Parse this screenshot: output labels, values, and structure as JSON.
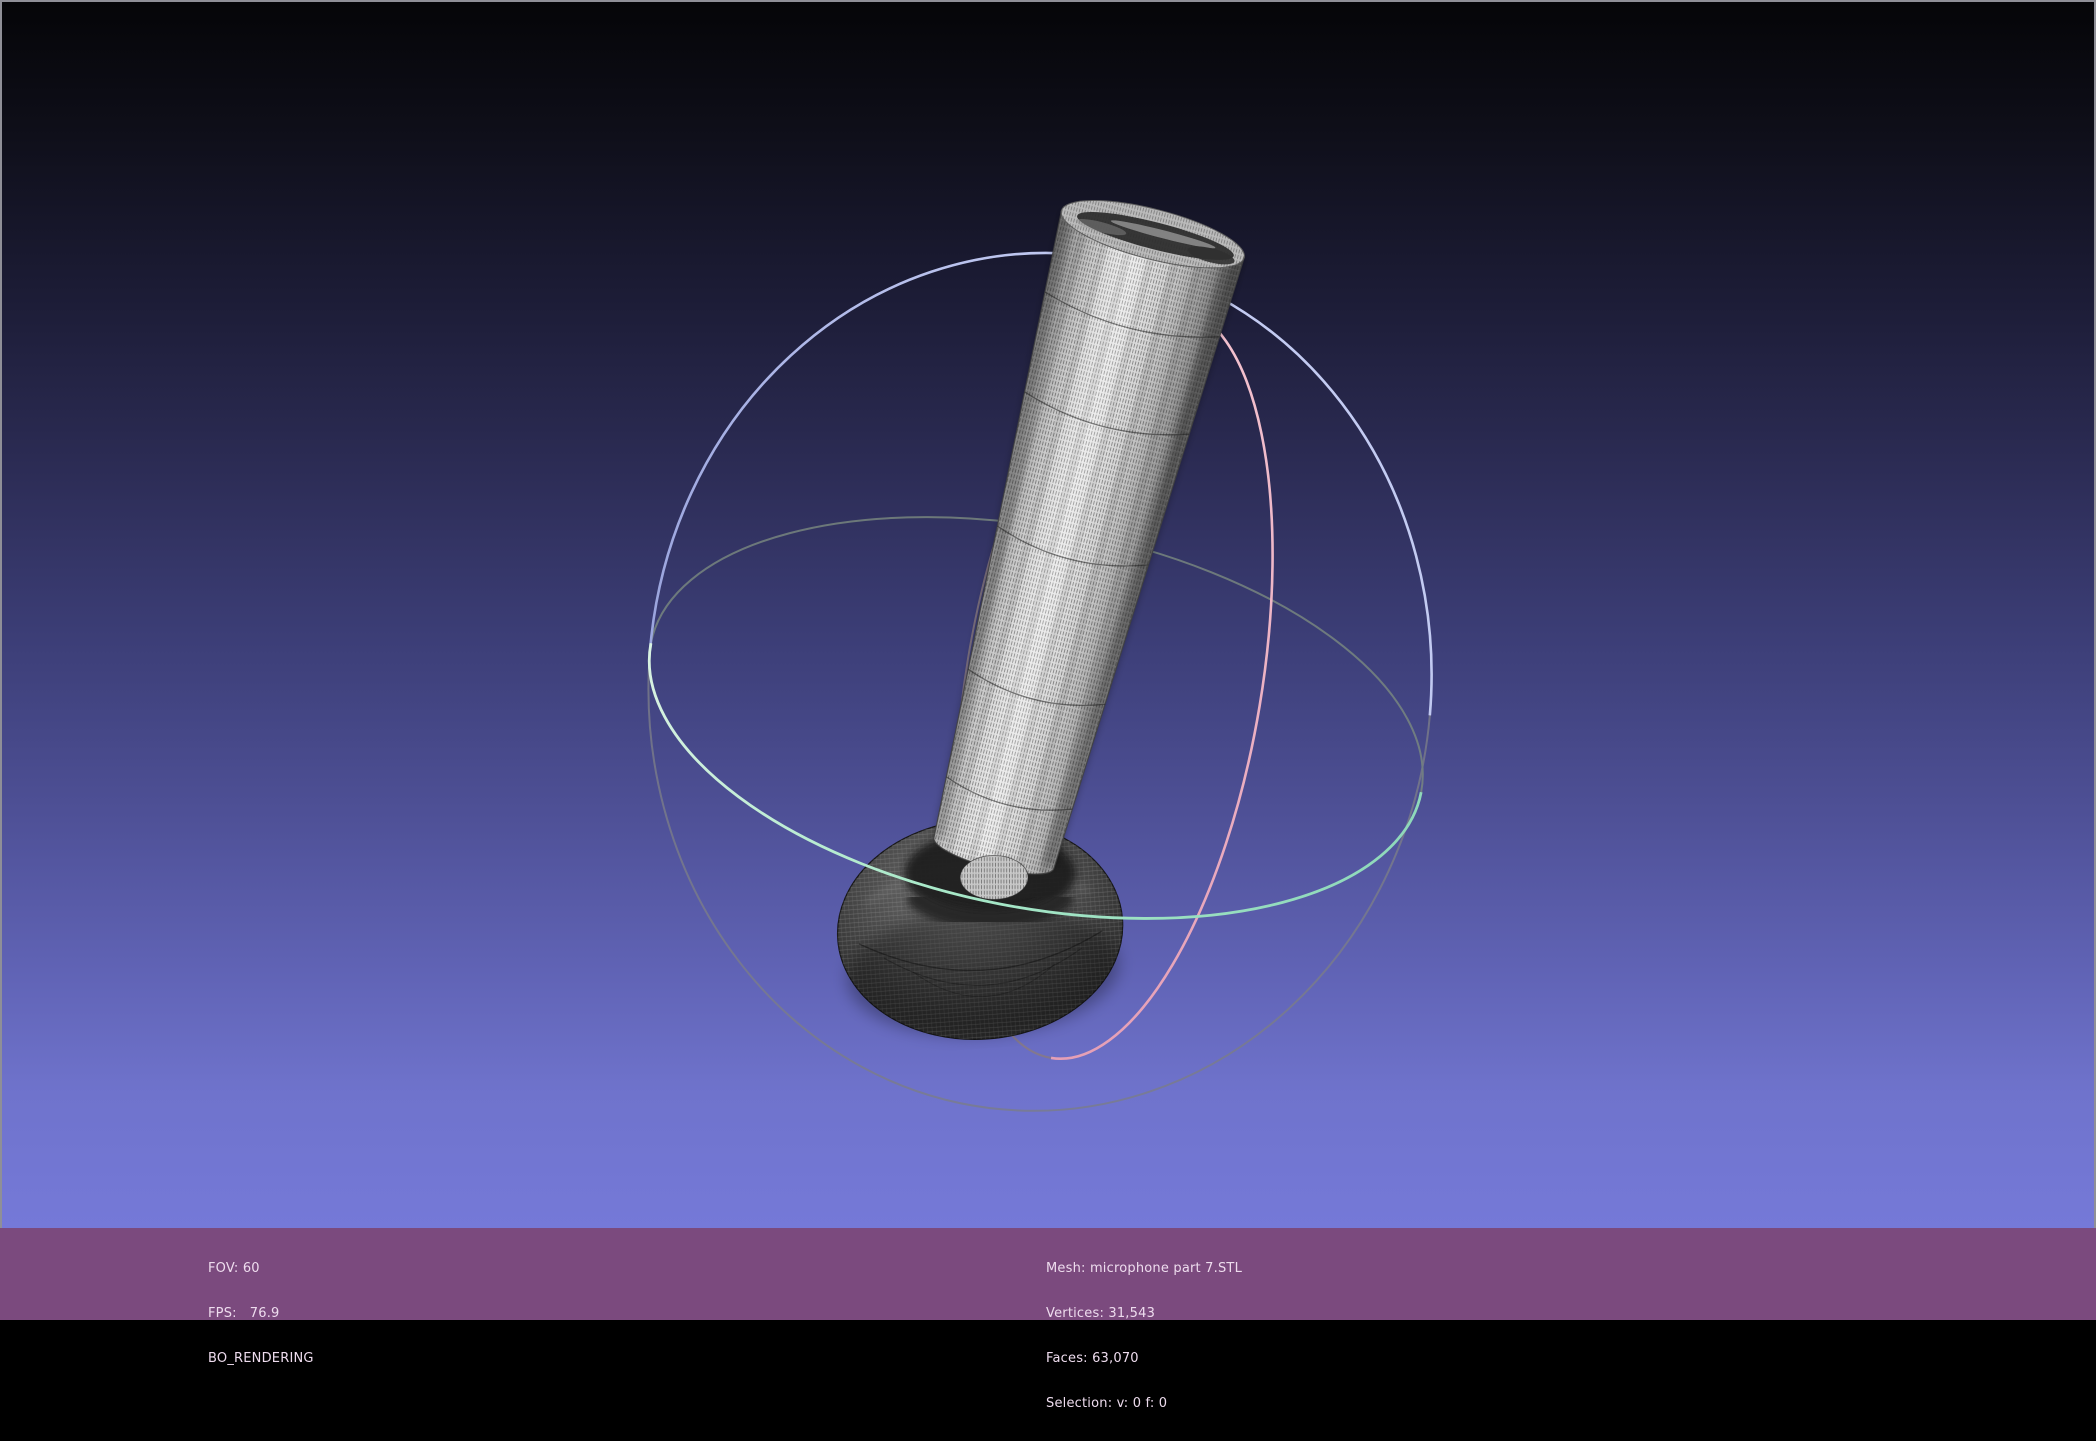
{
  "colors": {
    "bar_bg": "#7b4a7e",
    "status_text": "#eedcee",
    "bg_top": "#050508",
    "bg_bottom": "#7579d8",
    "ring_blue": "#aeb6ec",
    "ring_green": "#a9e9c9",
    "ring_pink": "#eeb1c4",
    "ring_back_gray": "#7d7d85"
  },
  "status_bar": {
    "left": {
      "fov": "FOV: 60",
      "fps": "FPS:   76.9",
      "mode": "BO_RENDERING"
    },
    "center": {
      "mesh": "Mesh: microphone part 7.STL",
      "vertices": "Vertices: 31,543",
      "faces": "Faces: 63,070",
      "selection": "Selection: v: 0 f: 0"
    }
  },
  "scene": {
    "object": "microphone part 7.STL wireframe mesh",
    "manipulator": "trackball with blue, green and pink rotation rings"
  }
}
